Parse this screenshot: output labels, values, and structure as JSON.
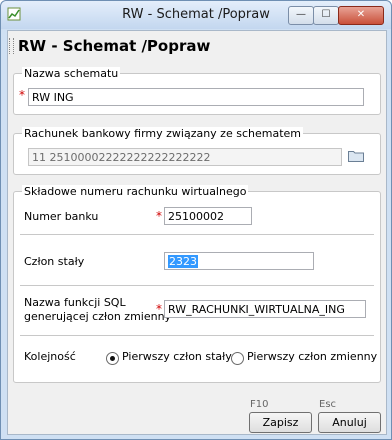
{
  "window": {
    "title": "RW - Schemat /Popraw",
    "min_label": "—",
    "max_label": "☐",
    "close_label": "✕"
  },
  "header": {
    "title": "RW - Schemat /Popraw"
  },
  "scheme_name": {
    "label": "Nazwa schematu",
    "required": "*",
    "value": "RW ING"
  },
  "bank_account": {
    "label": "Rachunek bankowy firmy związany ze schematem",
    "value": "11 25100002222222222222222"
  },
  "components": {
    "label": "Składowe numeru rachunku wirtualnego",
    "bank_number": {
      "label": "Numer banku",
      "required": "*",
      "value": "25100002"
    },
    "fixed_part": {
      "label": "Człon stały",
      "value": "2323"
    },
    "sql_function": {
      "label_line1": "Nazwa funkcji SQL",
      "label_line2": "generującej człon zmienny",
      "required": "*",
      "value": "RW_RACHUNKI_WIRTUALNA_ING"
    },
    "order": {
      "label": "Kolejność",
      "option1": "Pierwszy człon stały",
      "option2": "Pierwszy człon zmienny",
      "selected": "option1"
    }
  },
  "footer": {
    "save": {
      "shortcut": "F10",
      "label": "Zapisz"
    },
    "cancel": {
      "shortcut": "Esc",
      "label": "Anuluj"
    }
  },
  "colors": {
    "selection": "#3399ff",
    "required": "#d00000",
    "titlebar": "#c3d7ef"
  }
}
